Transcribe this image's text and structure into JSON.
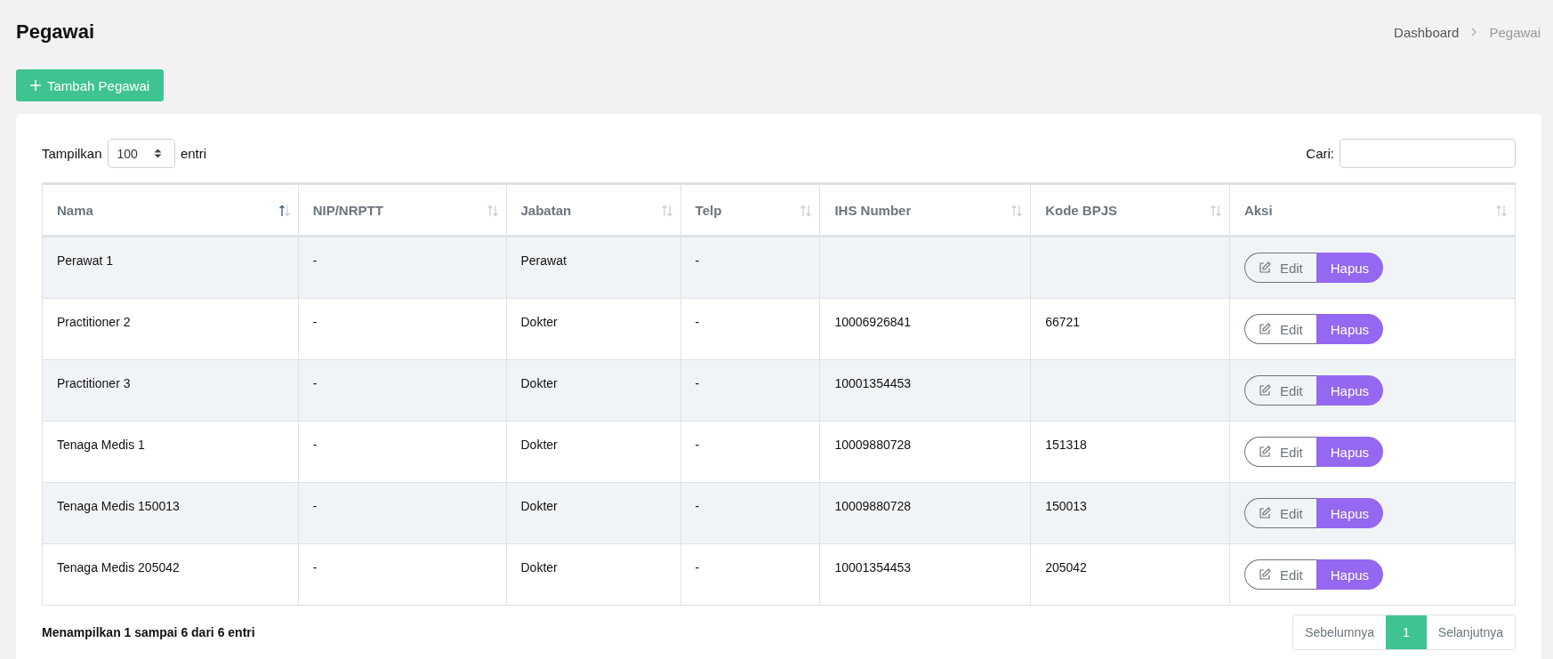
{
  "page": {
    "title": "Pegawai"
  },
  "breadcrumb": [
    {
      "label": "Dashboard",
      "current": false
    },
    {
      "label": "Pegawai",
      "current": true
    }
  ],
  "add_button": {
    "label": "Tambah Pegawai"
  },
  "length_control": {
    "prefix": "Tampilkan",
    "value": "100",
    "suffix": "entri"
  },
  "search": {
    "label": "Cari:"
  },
  "table": {
    "columns": [
      {
        "label": "Nama",
        "sorted": true
      },
      {
        "label": "NIP/NRPTT",
        "sorted": false
      },
      {
        "label": "Jabatan",
        "sorted": false
      },
      {
        "label": "Telp",
        "sorted": false
      },
      {
        "label": "IHS Number",
        "sorted": false
      },
      {
        "label": "Kode BPJS",
        "sorted": false
      },
      {
        "label": "Aksi",
        "sorted": false
      }
    ],
    "rows": [
      {
        "cells": [
          "Perawat 1",
          "-",
          "Perawat",
          "-",
          "",
          ""
        ],
        "edit": "Edit",
        "delete": "Hapus"
      },
      {
        "cells": [
          "Practitioner 2",
          "-",
          "Dokter",
          "-",
          "10006926841",
          "66721"
        ],
        "edit": "Edit",
        "delete": "Hapus"
      },
      {
        "cells": [
          "Practitioner 3",
          "-",
          "Dokter",
          "-",
          "10001354453",
          ""
        ],
        "edit": "Edit",
        "delete": "Hapus"
      },
      {
        "cells": [
          "Tenaga Medis 1",
          "-",
          "Dokter",
          "-",
          "10009880728",
          "151318"
        ],
        "edit": "Edit",
        "delete": "Hapus"
      },
      {
        "cells": [
          "Tenaga Medis 150013",
          "-",
          "Dokter",
          "-",
          "10009880728",
          "150013"
        ],
        "edit": "Edit",
        "delete": "Hapus"
      },
      {
        "cells": [
          "Tenaga Medis 205042",
          "-",
          "Dokter",
          "-",
          "10001354453",
          "205042"
        ],
        "edit": "Edit",
        "delete": "Hapus"
      }
    ]
  },
  "footer": {
    "info": "Menampilkan 1 sampai 6 dari 6 entri"
  },
  "pagination": [
    {
      "label": "Sebelumnya",
      "selected": false
    },
    {
      "label": "1",
      "selected": true
    },
    {
      "label": "Selanjutnya",
      "selected": false
    }
  ]
}
